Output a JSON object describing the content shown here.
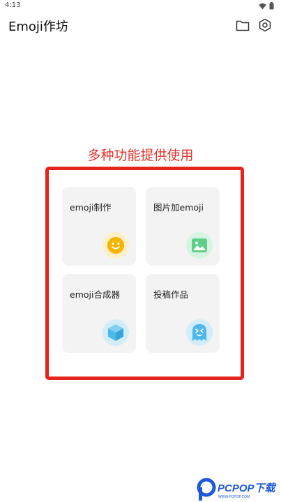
{
  "status_bar": {
    "time": "4:13"
  },
  "app_bar": {
    "title": "Emoji作坊",
    "icons": [
      "folder-icon",
      "settings-icon"
    ]
  },
  "caption": "多种功能提供使用",
  "cards": [
    {
      "label": "emoji制作",
      "icon": "smiley-icon",
      "icon_color": "#f5b400",
      "icon_bg": "#fdf0c8"
    },
    {
      "label": "图片加emoji",
      "icon": "image-icon",
      "icon_color": "#5fcf8a",
      "icon_bg": "#d6f4e1"
    },
    {
      "label": "emoji合成器",
      "icon": "cube-icon",
      "icon_color": "#4fb8ea",
      "icon_bg": "#d3ecf9"
    },
    {
      "label": "投稿作品",
      "icon": "ghost-icon",
      "icon_color": "#4fb8ea",
      "icon_bg": "#d3ecf9"
    }
  ],
  "colors": {
    "accent_red": "#e5241c",
    "caption_red": "#e0352b",
    "card_bg": "#f3f3f3"
  },
  "watermark": {
    "text": "PCPOP下载",
    "sub": "WWW.PCPOP.COM"
  }
}
